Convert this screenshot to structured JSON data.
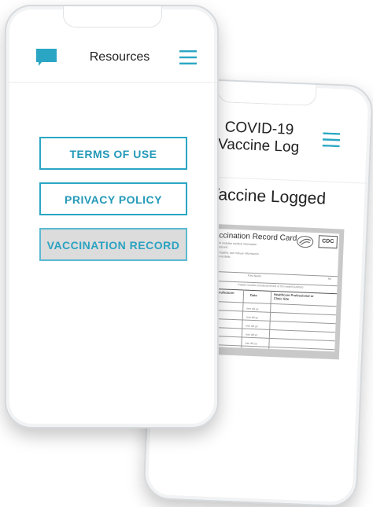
{
  "colors": {
    "accent": "#2aa6c4",
    "active_bg": "#dcdcdc",
    "text": "#222222"
  },
  "front_phone": {
    "title": "Resources",
    "icons": {
      "left": "chat-bubble-icon",
      "right": "hamburger-menu-icon"
    },
    "buttons": [
      {
        "label": "TERMS OF USE",
        "active": false
      },
      {
        "label": "PRIVACY POLICY",
        "active": false
      },
      {
        "label": "VACCINATION RECORD",
        "active": true
      }
    ]
  },
  "back_phone": {
    "title_line1": "COVID-19",
    "title_line2": "Vaccine Log",
    "icons": {
      "right": "hamburger-menu-icon"
    },
    "heading": "Vaccine Logged",
    "card": {
      "title": "Vaccination Record Card",
      "logo": "CDC",
      "line1": "d card, which includes medical information",
      "line2": "you have received.",
      "line3": "e tarjeta de registro, que incluye información",
      "line4": "unas que ha recibido.",
      "first_name": "First Name",
      "mi": "MI",
      "patient_number": "Patient number (medical record or IIS record number)",
      "col_product": "t Name/Manufacturer",
      "col_product2": "umber",
      "col_date": "Date",
      "col_site": "Healthcare Professional or",
      "col_site2": "Clinic Site",
      "date_placeholder": "mm dd yy"
    }
  }
}
